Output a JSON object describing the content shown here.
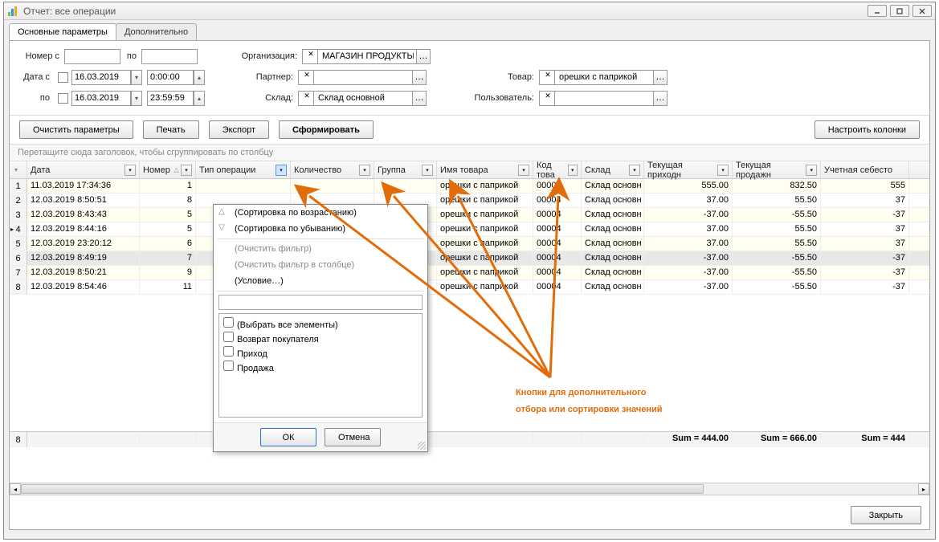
{
  "window": {
    "title": "Отчет: все операции"
  },
  "tabs": {
    "main": "Основные параметры",
    "extra": "Дополнительно"
  },
  "params": {
    "num_from_lbl": "Номер с",
    "num_to_lbl": "по",
    "date_from_lbl": "Дата с",
    "date_to_lbl": "по",
    "date_from": "16.03.2019",
    "time_from": "0:00:00",
    "date_to": "16.03.2019",
    "time_to": "23:59:59",
    "org_lbl": "Организация:",
    "org_val": "МАГАЗИН ПРОДУКТЫ",
    "partner_lbl": "Партнер:",
    "partner_val": "",
    "stock_lbl": "Склад:",
    "stock_val": "Склад основной",
    "goods_lbl": "Товар:",
    "goods_val": "орешки с паприкой",
    "user_lbl": "Пользователь:",
    "user_val": ""
  },
  "buttons": {
    "clear": "Очистить параметры",
    "print": "Печать",
    "export": "Экспорт",
    "build": "Сформировать",
    "cols": "Настроить колонки",
    "close": "Закрыть"
  },
  "grouphint": "Перетащите сюда заголовок, чтобы сгруппировать по столбцу",
  "headers": [
    "",
    "Дата",
    "Номер",
    "Тип операции",
    "Количество",
    "Группа",
    "Имя товара",
    "Код това",
    "Склад",
    "Текущая приходн",
    "Текущая продажн",
    "Учетная себесто"
  ],
  "rows": [
    {
      "n": "1",
      "date": "11.03.2019 17:34:36",
      "num": "1",
      "good": "орешки с паприкой",
      "code": "00004",
      "stock": "Склад основн",
      "in": "555.00",
      "out": "832.50",
      "cost": "555"
    },
    {
      "n": "2",
      "date": "12.03.2019 8:50:51",
      "num": "8",
      "good": "орешки с паприкой",
      "code": "00004",
      "stock": "Склад основн",
      "in": "37.00",
      "out": "55.50",
      "cost": "37"
    },
    {
      "n": "3",
      "date": "12.03.2019 8:43:43",
      "num": "5",
      "good": "орешки с паприкой",
      "code": "00004",
      "stock": "Склад основн",
      "in": "-37.00",
      "out": "-55.50",
      "cost": "-37"
    },
    {
      "n": "4",
      "date": "12.03.2019 8:44:16",
      "num": "5",
      "good": "орешки с паприкой",
      "code": "00004",
      "stock": "Склад основн",
      "in": "37.00",
      "out": "55.50",
      "cost": "37"
    },
    {
      "n": "5",
      "date": "12.03.2019 23:20:12",
      "num": "6",
      "good": "орешки с паприкой",
      "code": "00004",
      "stock": "Склад основн",
      "in": "37.00",
      "out": "55.50",
      "cost": "37"
    },
    {
      "n": "6",
      "date": "12.03.2019 8:49:19",
      "num": "7",
      "good": "орешки с паприкой",
      "code": "00004",
      "stock": "Склад основн",
      "in": "-37.00",
      "out": "-55.50",
      "cost": "-37"
    },
    {
      "n": "7",
      "date": "12.03.2019 8:50:21",
      "num": "9",
      "good": "орешки с паприкой",
      "code": "00004",
      "stock": "Склад основн",
      "in": "-37.00",
      "out": "-55.50",
      "cost": "-37"
    },
    {
      "n": "8",
      "date": "12.03.2019 8:54:46",
      "num": "11",
      "good": "орешки с паприкой",
      "code": "00004",
      "stock": "Склад основн",
      "in": "-37.00",
      "out": "-55.50",
      "cost": "-37"
    }
  ],
  "footer": {
    "count": "8",
    "sum_in": "Sum = 444.00",
    "sum_out": "Sum = 666.00",
    "sum_cost": "Sum = 444"
  },
  "fmenu": {
    "sort_asc": "(Сортировка по возрастанию)",
    "sort_desc": "(Сортировка по убыванию)",
    "clear_filter": "(Очистить фильтр)",
    "clear_col": "(Очистить фильтр в столбце)",
    "condition": "(Условие…)",
    "select_all": "(Выбрать все элементы)",
    "opt1": "Возврат покупателя",
    "opt2": "Приход",
    "opt3": "Продажа",
    "ok": "ОК",
    "cancel": "Отмена"
  },
  "annotation": "Кнопки для дополнительного\nотбора или сортировки значений"
}
